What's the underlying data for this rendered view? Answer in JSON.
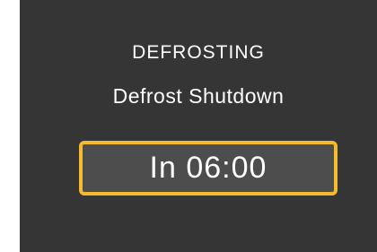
{
  "panel": {
    "status": "DEFROSTING",
    "mode": "Defrost Shutdown",
    "countdown": "In 06:00",
    "accent_color": "#f5b92d"
  }
}
